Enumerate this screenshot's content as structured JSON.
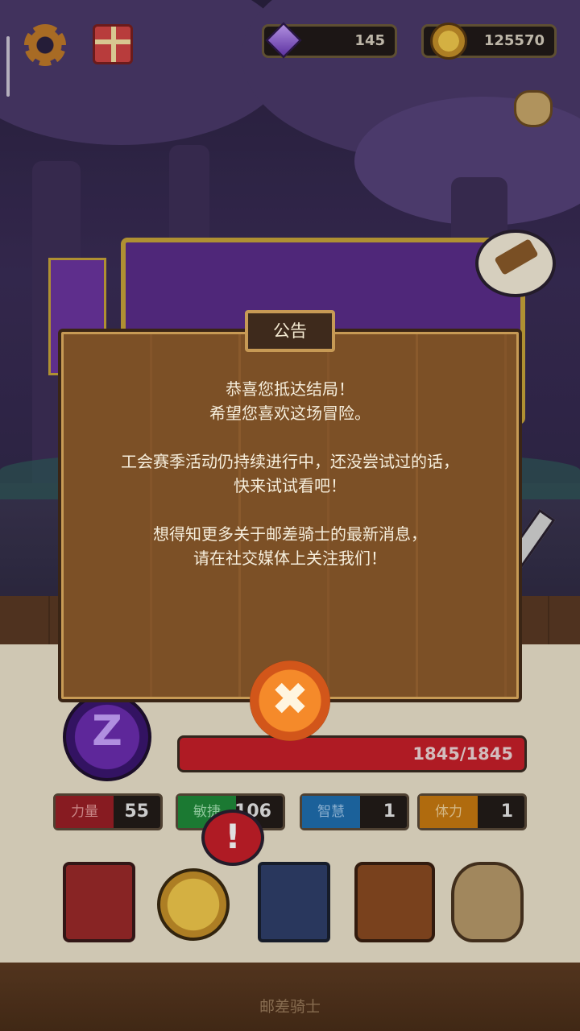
{
  "hud": {
    "gems": "145",
    "gold": "125570",
    "icons": [
      "gear-icon",
      "gift-icon",
      "gem-icon",
      "coin-icon",
      "sack-icon",
      "hammer-icon"
    ]
  },
  "dialog": {
    "title": "公告",
    "lines": [
      "恭喜您抵达结局！",
      "希望您喜欢这场冒险。",
      "工会赛季活动仍持续进行中，还没尝试过的话，",
      "快来试试看吧！",
      "想得知更多关于邮差骑士的最新消息，",
      "请在社交媒体上关注我们！"
    ],
    "close_symbol": "✖"
  },
  "character": {
    "avatar_letter": "Z",
    "hp_text": "1845/1845",
    "hp_fraction": 1.0
  },
  "stats": [
    {
      "label": "力量",
      "value": "55"
    },
    {
      "label": "敏捷",
      "value": "106"
    },
    {
      "label": "智慧",
      "value": "1"
    },
    {
      "label": "体力",
      "value": "1"
    }
  ],
  "alert_mark": "!",
  "footer": {
    "title": "邮差骑士"
  },
  "colors": {
    "hp": "#c81f2a",
    "strength": "#9a1f26",
    "agility": "#1f8a3a",
    "wisdom": "#1f6fb0",
    "vitality": "#c97a10"
  }
}
